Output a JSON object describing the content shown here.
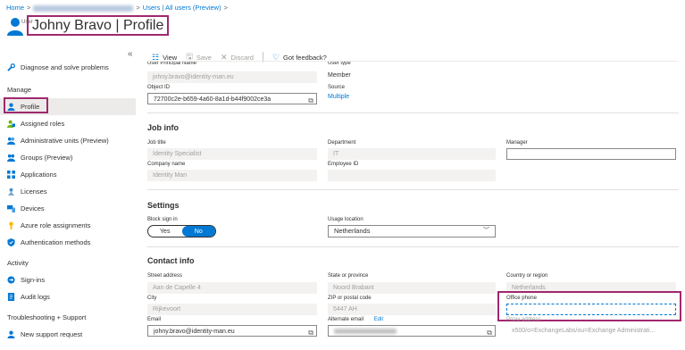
{
  "breadcrumb": {
    "home": "Home",
    "sep": ">",
    "users": "Users | All users (Preview)"
  },
  "header": {
    "title": "Johny Bravo | Profile",
    "subtitle": "User"
  },
  "sidebar": {
    "top_items": [
      {
        "label": "Diagnose and solve problems",
        "icon": "wrench-icon"
      }
    ],
    "sections": [
      {
        "title": "Manage",
        "items": [
          {
            "label": "Profile",
            "icon": "user-icon"
          },
          {
            "label": "Assigned roles",
            "icon": "roles-icon"
          },
          {
            "label": "Administrative units (Preview)",
            "icon": "admin-units-icon"
          },
          {
            "label": "Groups (Preview)",
            "icon": "groups-icon"
          },
          {
            "label": "Applications",
            "icon": "apps-icon"
          },
          {
            "label": "Licenses",
            "icon": "license-icon"
          },
          {
            "label": "Devices",
            "icon": "devices-icon"
          },
          {
            "label": "Azure role assignments",
            "icon": "key-icon"
          },
          {
            "label": "Authentication methods",
            "icon": "shield-icon"
          }
        ]
      },
      {
        "title": "Activity",
        "items": [
          {
            "label": "Sign-ins",
            "icon": "signin-icon"
          },
          {
            "label": "Audit logs",
            "icon": "audit-icon"
          }
        ]
      },
      {
        "title": "Troubleshooting + Support",
        "items": [
          {
            "label": "New support request",
            "icon": "support-icon"
          }
        ]
      }
    ]
  },
  "toolbar": {
    "view": "View",
    "save": "Save",
    "discard": "Discard",
    "feedback": "Got feedback?"
  },
  "identity": {
    "upn_label": "User Principal Name",
    "upn_value": "johny.bravo@identity-man.eu",
    "usertype_label": "User type",
    "usertype_value": "Member",
    "objectid_label": "Object ID",
    "objectid_value": "72700c2e-b659-4a60-8a1d-b44f9002ce3a",
    "source_label": "Source",
    "source_value": "Multiple"
  },
  "job_info": {
    "title": "Job info",
    "job_title_label": "Job title",
    "job_title_value": "Identity Specialist",
    "department_label": "Department",
    "department_value": "IT",
    "manager_label": "Manager",
    "company_label": "Company name",
    "company_value": "Identity Man",
    "employee_id_label": "Employee ID"
  },
  "settings": {
    "title": "Settings",
    "block_label": "Block sign in",
    "yes": "Yes",
    "no": "No",
    "usage_label": "Usage location",
    "usage_value": "Netherlands"
  },
  "contact": {
    "title": "Contact info",
    "street_label": "Street address",
    "street_value": "Aan de Capelle 4",
    "state_label": "State or province",
    "state_value": "Noord Brabant",
    "country_label": "Country or region",
    "country_value": "Netherlands",
    "city_label": "City",
    "city_value": "Rijkevoort",
    "zip_label": "ZIP or postal code",
    "zip_value": "5447 AH",
    "office_phone_label": "Office phone",
    "email_label": "Email",
    "email_value": "johny.bravo@identity-man.eu",
    "alt_email_label": "Alternate email",
    "alt_email_edit": "Edit",
    "proxy_label": "Proxy address",
    "proxy_value": "x500/o=ExchangeLabs/ou=Exchange Administrati..."
  }
}
